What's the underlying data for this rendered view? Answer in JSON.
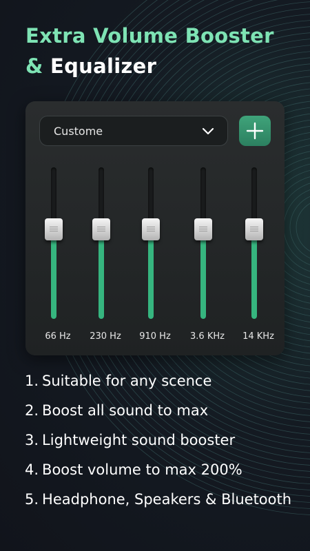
{
  "title": {
    "line1": "Extra Volume Booster",
    "amp": "&",
    "line2": "Equalizer"
  },
  "equalizer": {
    "preset": "Custome",
    "add_icon": "plus-icon",
    "dropdown_icon": "chevron-down-icon",
    "bands": [
      {
        "label": "66 Hz",
        "level": 0.59
      },
      {
        "label": "230 Hz",
        "level": 0.59
      },
      {
        "label": "910 Hz",
        "level": 0.59
      },
      {
        "label": "3.6 KHz",
        "level": 0.59
      },
      {
        "label": "14 KHz",
        "level": 0.59
      }
    ]
  },
  "features": [
    {
      "num": "1.",
      "text": "Suitable for any scence"
    },
    {
      "num": "2.",
      "text": "Boost all sound to max"
    },
    {
      "num": "3.",
      "text": "Lightweight sound booster"
    },
    {
      "num": "4.",
      "text": "Boost volume to max 200%"
    },
    {
      "num": "5.",
      "text": "Headphone, Speakers & Bluetooth"
    }
  ],
  "colors": {
    "accent": "#7ee3b4",
    "slider_fill": "#36b57f",
    "button": "#3fa37a",
    "background": "#141a22"
  }
}
